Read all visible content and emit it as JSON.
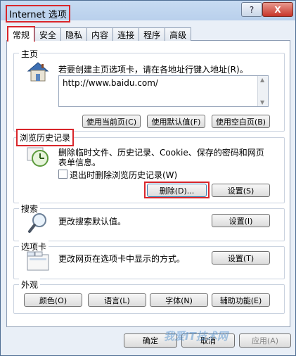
{
  "window": {
    "title": "Internet 选项",
    "help_label": "?",
    "close_label": "X"
  },
  "tabs": [
    {
      "label": "常规"
    },
    {
      "label": "安全"
    },
    {
      "label": "隐私"
    },
    {
      "label": "内容"
    },
    {
      "label": "连接"
    },
    {
      "label": "程序"
    },
    {
      "label": "高级"
    }
  ],
  "home": {
    "legend": "主页",
    "desc": "若要创建主页选项卡，请在各地址行键入地址(R)。",
    "url": "http://www.baidu.com/",
    "btn_current": "使用当前页(C)",
    "btn_default": "使用默认值(F)",
    "btn_blank": "使用空白页(B)"
  },
  "history": {
    "legend": "浏览历史记录",
    "desc_line1": "删除临时文件、历史记录、Cookie、保存的密码和网页",
    "desc_line2": "表单信息。",
    "checkbox_label": "退出时删除浏览历史记录(W)",
    "btn_delete": "删除(D)...",
    "btn_settings": "设置(S)"
  },
  "search": {
    "legend": "搜索",
    "desc": "更改搜索默认值。",
    "btn_settings": "设置(I)"
  },
  "tabs_section": {
    "legend": "选项卡",
    "desc": "更改网页在选项卡中显示的方式。",
    "btn_settings": "设置(T)"
  },
  "appearance": {
    "legend": "外观",
    "btn_colors": "颜色(O)",
    "btn_languages": "语言(L)",
    "btn_fonts": "字体(N)",
    "btn_accessibility": "辅助功能(E)"
  },
  "footer": {
    "btn_ok": "确定",
    "btn_cancel": "取消",
    "btn_apply": "应用(A)"
  },
  "watermark": "我爱IT技术网"
}
